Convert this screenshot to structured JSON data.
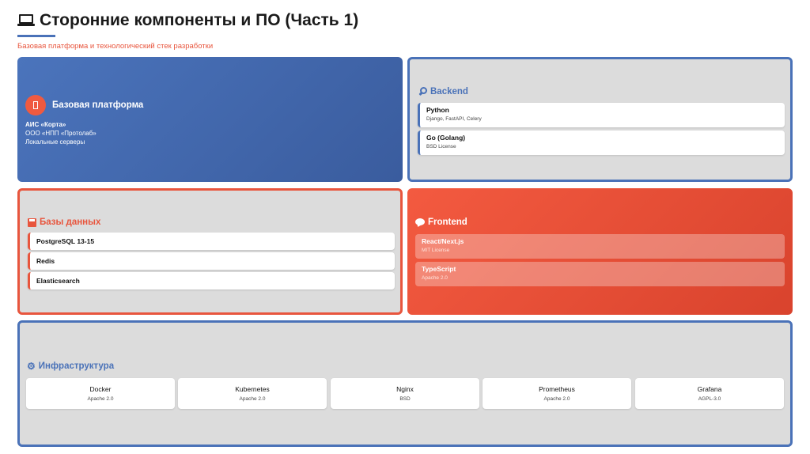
{
  "header": {
    "title": "Сторонние компоненты и ПО (Часть 1)",
    "subtitle": "Базовая платформа и технологический стек разработки",
    "icon": "laptop-icon"
  },
  "colors": {
    "accent_blue": "#4a72b8",
    "accent_red": "#e8553d",
    "card_bg": "#dcdcdc"
  },
  "base_platform": {
    "title": "Базовая платформа",
    "icon": "platform-icon",
    "lines": [
      "АИС «Корта»",
      "ООО «НПП «Протолаб»",
      "Локальные серверы"
    ]
  },
  "backend": {
    "title": "Backend",
    "icon": "wrench-icon",
    "items": [
      {
        "name": "Python",
        "license": "Django, FastAPI, Celery"
      },
      {
        "name": "Go (Golang)",
        "license": "BSD License"
      }
    ]
  },
  "databases": {
    "title": "Базы данных",
    "icon": "floppy-icon",
    "items": [
      {
        "name": "PostgreSQL 13-15"
      },
      {
        "name": "Redis"
      },
      {
        "name": "Elasticsearch"
      }
    ]
  },
  "frontend": {
    "title": "Frontend",
    "icon": "speech-bubble-icon",
    "items": [
      {
        "name": "React/Next.js",
        "license": "MIT License"
      },
      {
        "name": "TypeScript",
        "license": "Apache 2.0"
      }
    ]
  },
  "infrastructure": {
    "title": "Инфраструктура",
    "icon": "gear-icon",
    "items": [
      {
        "name": "Docker",
        "license": "Apache 2.0"
      },
      {
        "name": "Kubernetes",
        "license": "Apache 2.0"
      },
      {
        "name": "Nginx",
        "license": "BSD"
      },
      {
        "name": "Prometheus",
        "license": "Apache 2.0"
      },
      {
        "name": "Grafana",
        "license": "AGPL-3.0"
      }
    ]
  }
}
